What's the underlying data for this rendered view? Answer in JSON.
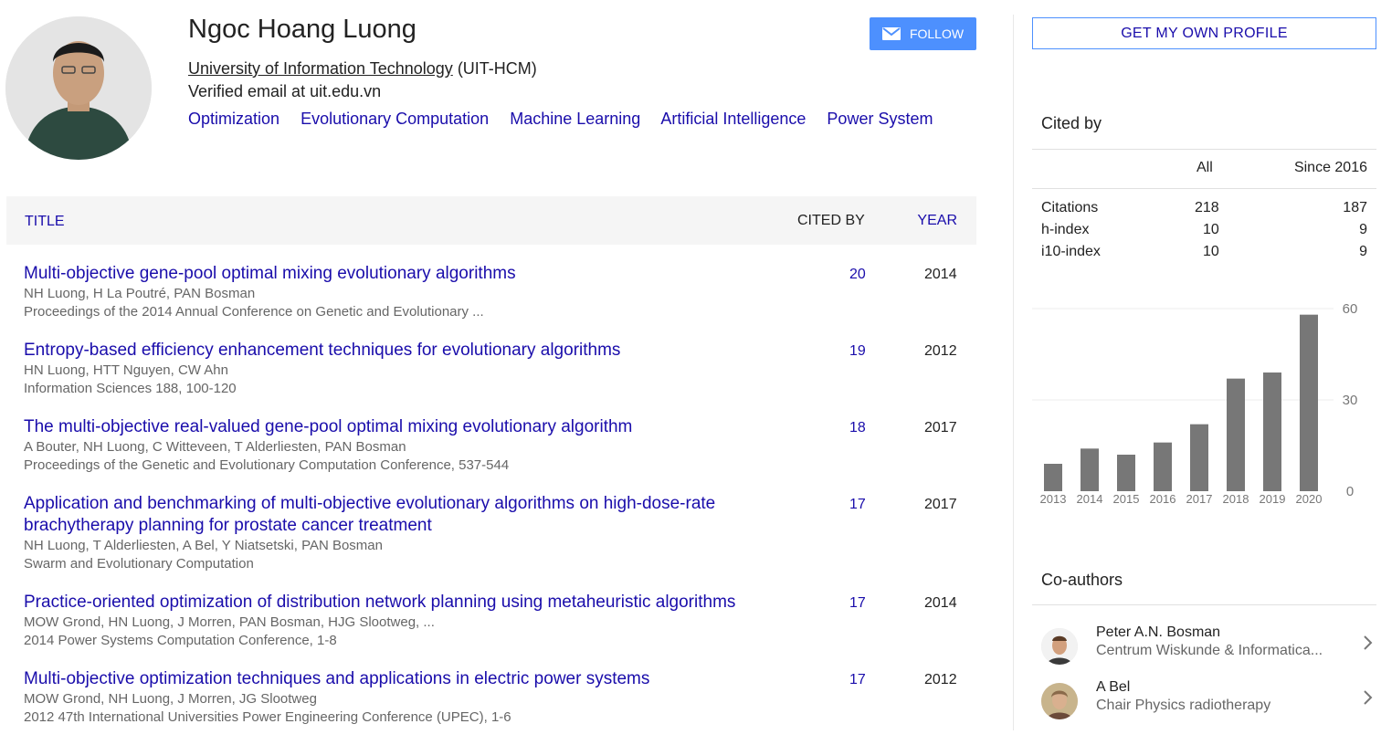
{
  "profile": {
    "name": "Ngoc Hoang Luong",
    "affiliation_link": "University of Information Technology",
    "affiliation_suffix": " (UIT-HCM)",
    "email": "Verified email at uit.edu.vn",
    "interests": [
      "Optimization",
      "Evolutionary Computation",
      "Machine Learning",
      "Artificial Intelligence",
      "Power System"
    ],
    "follow_label": "FOLLOW"
  },
  "table": {
    "headers": {
      "title": "TITLE",
      "cited_by": "CITED BY",
      "year": "YEAR"
    },
    "rows": [
      {
        "title": "Multi-objective gene-pool optimal mixing evolutionary algorithms",
        "authors": "NH Luong, H La Poutré, PAN Bosman",
        "venue": "Proceedings of the 2014 Annual Conference on Genetic and Evolutionary ...",
        "cites": "20",
        "year": "2014"
      },
      {
        "title": "Entropy-based efficiency enhancement techniques for evolutionary algorithms",
        "authors": "HN Luong, HTT Nguyen, CW Ahn",
        "venue": "Information Sciences 188, 100-120",
        "cites": "19",
        "year": "2012"
      },
      {
        "title": "The multi-objective real-valued gene-pool optimal mixing evolutionary algorithm",
        "authors": "A Bouter, NH Luong, C Witteveen, T Alderliesten, PAN Bosman",
        "venue": "Proceedings of the Genetic and Evolutionary Computation Conference, 537-544",
        "cites": "18",
        "year": "2017"
      },
      {
        "title": "Application and benchmarking of multi-objective evolutionary algorithms on high-dose-rate brachytherapy planning for prostate cancer treatment",
        "authors": "NH Luong, T Alderliesten, A Bel, Y Niatsetski, PAN Bosman",
        "venue": "Swarm and Evolutionary Computation",
        "cites": "17",
        "year": "2017"
      },
      {
        "title": "Practice-oriented optimization of distribution network planning using metaheuristic algorithms",
        "authors": "MOW Grond, HN Luong, J Morren, PAN Bosman, HJG Slootweg, ...",
        "venue": "2014 Power Systems Computation Conference, 1-8",
        "cites": "17",
        "year": "2014"
      },
      {
        "title": "Multi-objective optimization techniques and applications in electric power systems",
        "authors": "MOW Grond, NH Luong, J Morren, JG Slootweg",
        "venue": "2012 47th International Universities Power Engineering Conference (UPEC), 1-6",
        "cites": "17",
        "year": "2012"
      }
    ]
  },
  "sidebar": {
    "get_profile_label": "GET MY OWN PROFILE",
    "cited_by_title": "Cited by",
    "stats_headers": {
      "all": "All",
      "since": "Since 2016"
    },
    "stats": [
      {
        "label": "Citations",
        "all": "218",
        "since": "187"
      },
      {
        "label": "h-index",
        "all": "10",
        "since": "9"
      },
      {
        "label": "i10-index",
        "all": "10",
        "since": "9"
      }
    ],
    "coauthors_title": "Co-authors",
    "coauthors": [
      {
        "name": "Peter A.N. Bosman",
        "affiliation": "Centrum Wiskunde & Informatica..."
      },
      {
        "name": "A Bel",
        "affiliation": "Chair Physics radiotherapy"
      }
    ]
  },
  "chart_data": {
    "type": "bar",
    "categories": [
      "2013",
      "2014",
      "2015",
      "2016",
      "2017",
      "2018",
      "2019",
      "2020"
    ],
    "values": [
      9,
      14,
      12,
      16,
      22,
      37,
      39,
      58
    ],
    "ylim": [
      0,
      60
    ],
    "yticks": [
      "0",
      "30",
      "60"
    ],
    "bar_color": "#777777",
    "grid": true
  }
}
